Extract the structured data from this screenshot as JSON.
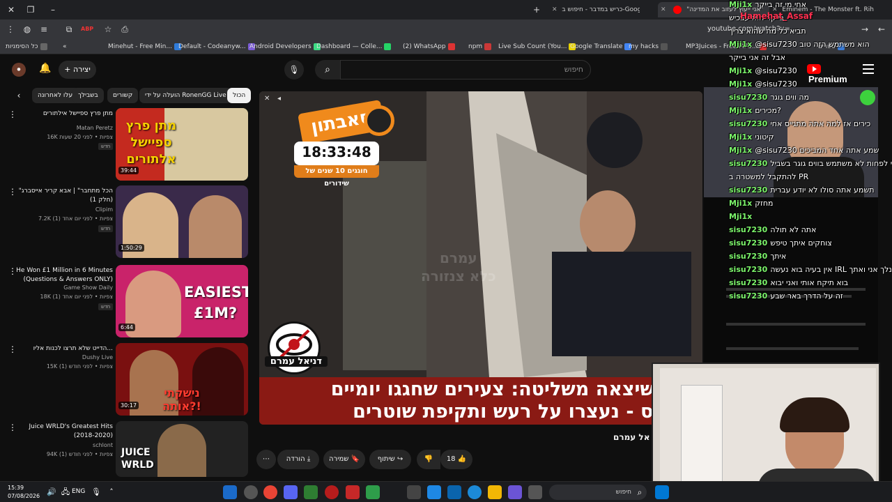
{
  "browser": {
    "tabs": [
      {
        "label": "Eminem - The Monster ft. Riha",
        "color": "#ff0000"
      },
      {
        "label": "\"אני ייעוץ לעזוב את המדינה\"",
        "color": "#ff0000"
      },
      {
        "label": "כריש במדבר - חיפוש ב-Google",
        "color": "#4285f4"
      }
    ],
    "url": "youtube.com/watch?v=...",
    "bookmarks": [
      {
        "label": "ספריםי",
        "color": "#3a7bd5"
      },
      {
        "label": "MP3Juices - Free MP3...",
        "color": "#d33"
      },
      {
        "label": "my hacks",
        "color": "#555"
      },
      {
        "label": "Google Translate",
        "color": "#4285f4"
      },
      {
        "label": "Live Sub Count (You...",
        "color": "#e8d200"
      },
      {
        "label": "npm",
        "color": "#cb3837"
      },
      {
        "label": "(2) WhatsApp",
        "color": "#25d366"
      },
      {
        "label": "Dashboard — Colle...",
        "color": "#d33"
      },
      {
        "label": "Android Developers",
        "color": "#3ddc84"
      },
      {
        "label": "Default - Codeanyw...",
        "color": "#7b5cd6"
      },
      {
        "label": "Minehut - Free Min...",
        "color": "#2f7bd9"
      },
      {
        "label": "כל הסימניות",
        "color": "#666"
      }
    ]
  },
  "youtube": {
    "logo": "Premium",
    "search_placeholder": "חיפוש",
    "create_label": "יצירה",
    "chips": [
      {
        "label": "הכול",
        "selected": true
      },
      {
        "label": "הועלה על ידי RonenGG Live",
        "selected": false
      },
      {
        "label": "קשורים",
        "selected": false
      },
      {
        "label": "בשבילך",
        "selected": false
      },
      {
        "label": "הועלו לאחרונה",
        "selected": false
      }
    ],
    "recommendations": [
      {
        "title": "מתן פרץ ספיישל אילתורים",
        "channel": "Matan Peretz",
        "meta": "16K צפיות • לפני 20 שעות",
        "badge": "חדש",
        "duration": "39:44",
        "thumb_text": "מתן פרץ ספיישל אלתורים",
        "thumb_color": "#6a8f3a"
      },
      {
        "title": "\"הכל מתחבר\" | אבא קריר אייסברג (חלק 1)",
        "channel": "Clipim",
        "meta": "7.2K צפיות • לפני יום אחד (1)",
        "badge": "חדש",
        "duration": "1:50:29",
        "thumb_text": "",
        "thumb_color": "#3a2a4a"
      },
      {
        "title": "He Won £1 Million in 6 Minutes (Questions & Answers ONLY)",
        "channel": "Game Show Daily",
        "meta": "18K צפיות • לפני יום אחד (1)",
        "badge": "חדש",
        "duration": "6:44",
        "thumb_text": "EASIEST £1M?",
        "thumb_color": "#c9236a"
      },
      {
        "title": "הדייט שלא תרצו לכנות אליו...",
        "channel": "Dushy Live",
        "meta": "15K צפיות • לפני חודש (1)",
        "badge": "",
        "duration": "30:17",
        "thumb_text": "נישקתי אותה?!",
        "thumb_color": "#7a1010"
      },
      {
        "title": "Juice WRLD's Greatest Hits (2018-2020)",
        "channel": "schlont",
        "meta": "94K צפיות • לפני חודש (1)",
        "badge": "",
        "duration": "",
        "thumb_text": "JUICE WRLD",
        "thumb_color": "#222"
      }
    ],
    "player": {
      "badge_title": "סאבתון",
      "badge_clock": "18:33:48",
      "badge_sub": "חוגגים 10 שנים של שידורים",
      "watermark_line1": "עמרם",
      "watermark_line2": "כלא צנזורה",
      "eye_name": "דניאל עמרם",
      "banner_line1": "גיוס שיצאה משליטה: צעירים שחגגו יומיים",
      "banner_line2": "הגיוס - נעצרו על רעש ותקיפת שוטרים:"
    },
    "channel_caption": "אל עמרם",
    "actions": {
      "likes": "18",
      "share": "שיתוף",
      "save": "שמירה",
      "download": "הורדה"
    }
  },
  "chat": {
    "top_user": "Hamehat_Assaf",
    "top_message": "בייקר הוא עבכיש",
    "lines": [
      {
        "user": "Mji1x",
        "msg": "אחי מי זה בייקר"
      },
      {
        "user": "",
        "msg": "בייקר הוא עבכיש"
      },
      {
        "user": "",
        "msg": "תביא כל מה שהוא צריך"
      },
      {
        "user": "Mji1x",
        "msg": "@sisu7230 הוא משתמש הזה טוב"
      },
      {
        "user": "",
        "msg": "אבל זה אני בייקר"
      },
      {
        "user": "Mji1x",
        "msg": "@sisu7230"
      },
      {
        "user": "Mji1x",
        "msg": "@sisu7230"
      },
      {
        "user": "sisu7230",
        "msg": "מה ווים גוגר"
      },
      {
        "user": "Mji1x",
        "msg": "מכירים?"
      },
      {
        "user": "sisu7230",
        "msg": "כירים אז למה אתה מתגייס אחי"
      },
      {
        "user": "Mji1x",
        "msg": "קיטוני"
      },
      {
        "user": "Mji1x",
        "msg": "@sisu7230 שמע אתה אחד המביכים"
      },
      {
        "user": "sisu7230",
        "msg": "אני לפחות לא משתמש בווים גוגר בשביל"
      },
      {
        "user": "",
        "msg": "להתקבל למשטרה ב PR"
      },
      {
        "user": "sisu7230",
        "msg": "תשמע אתה סולו לא יודע עברית"
      },
      {
        "user": "Mji1x",
        "msg": "מחזק"
      },
      {
        "user": "Mji1x",
        "msg": ""
      },
      {
        "user": "sisu7230",
        "msg": "אתה לא תולה"
      },
      {
        "user": "sisu7230",
        "msg": "צוחקים איתך טיפש"
      },
      {
        "user": "sisu7230",
        "msg": "איתך"
      },
      {
        "user": "sisu7230",
        "msg": "אין בעיה בוא נעשה IRL ונלך אני ואתך"
      },
      {
        "user": "sisu7230",
        "msg": "בוא תיקח אותי ואני יבוא"
      },
      {
        "user": "sisu7230",
        "msg": "זה על הדרך באר שבע"
      }
    ]
  },
  "taskbar": {
    "time": "15:39",
    "date": "07/08/2026",
    "lang": "ENG",
    "search": "חיפוש"
  }
}
